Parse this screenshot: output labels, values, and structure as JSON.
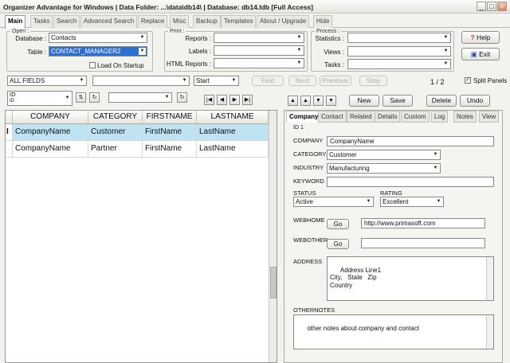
{
  "window": {
    "title": "Organizer Advantage for Windows | Data Folder: ...\\data\\db14\\ | Database: db14.ldb [Full Access]",
    "min": "_",
    "max": "□",
    "close": "×"
  },
  "tabs": [
    "Main",
    "Tasks",
    "Search",
    "Advanced Search",
    "Replace",
    "Misc",
    "Backup",
    "Templates",
    "About / Upgrade",
    "Hide"
  ],
  "open_group": {
    "legend": "Open :",
    "database_label": "Database :",
    "database_value": "Contacts",
    "table_label": "Table :",
    "table_value": "CONTACT_MANAGER2",
    "load_on_startup": "Load On Startup"
  },
  "print_group": {
    "legend": "Print :",
    "reports_label": "Reports :",
    "labels_label": "Labels :",
    "html_reports_label": "HTML Reports :"
  },
  "process_group": {
    "legend": "Process :",
    "statistics_label": "Statistics :",
    "views_label": "Views :",
    "tasks_label": "Tasks :"
  },
  "help_btn": "Help",
  "exit_btn": "Exit",
  "search_bar": {
    "field": "ALL FIELDS",
    "start": "Start",
    "find": "Find",
    "next": "Next",
    "previous": "Previous",
    "stop": "Stop",
    "page": "1 / 2",
    "split_panels": "Split Panels"
  },
  "sort": {
    "field": "ID",
    "sub": "ID"
  },
  "grid": {
    "columns": [
      "COMPANY",
      "CATEGORY",
      "FIRSTNAME",
      "LASTNAME"
    ],
    "rows": [
      [
        "CompanyName",
        "Customer",
        "FirstName",
        "LastName"
      ],
      [
        "CompanyName",
        "Partner",
        "FirstName",
        "LastName"
      ]
    ],
    "current_marker": "I"
  },
  "record_buttons": {
    "new": "New",
    "save": "Save",
    "delete": "Delete",
    "undo": "Undo"
  },
  "detail_tabs": [
    "Company",
    "Contact",
    "Related",
    "Details",
    "Custom",
    "Log",
    "Notes",
    "View"
  ],
  "detail": {
    "id_label": "ID 1",
    "company_label": "COMPANY",
    "company": "CompanyName",
    "category_label": "CATEGORY",
    "category": "Customer",
    "industry_label": "INDUSTRY",
    "industry": "Manufacturing",
    "keyword_label": "KEYWORD",
    "keyword": "",
    "status_label": "STATUS",
    "status": "Active",
    "rating_label": "RATING",
    "rating": "Excellent",
    "webhome_label": "WEBHOME",
    "webhome": "http://www.primasoft.com",
    "webother_label": "WEBOTHER",
    "webother": "",
    "go": "Go",
    "address_label": "ADDRESS",
    "address": "Address Line1\nCity,   State   Zip\nCountry",
    "othernotes_label": "OTHERNOTES",
    "othernotes": "other notes about company and contact"
  }
}
